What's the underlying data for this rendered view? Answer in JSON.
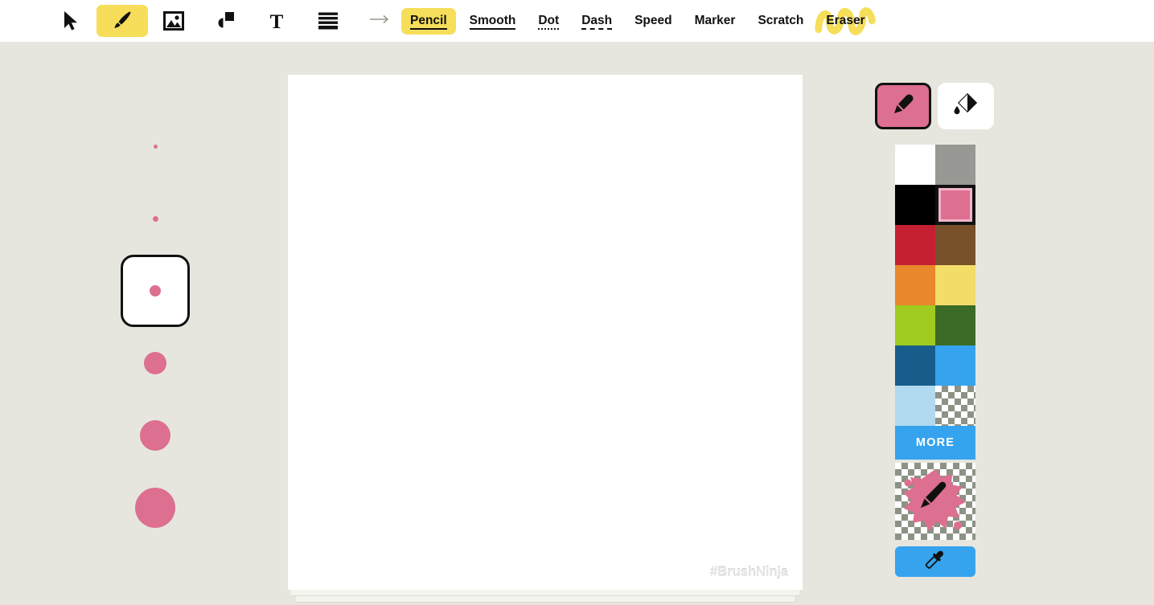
{
  "app": {
    "watermark": "#BrushNinja"
  },
  "toolbar": {
    "icon_tools": [
      {
        "name": "select-tool",
        "icon": "cursor-arrow-icon",
        "active": false
      },
      {
        "name": "brush-tool",
        "icon": "paintbrush-icon",
        "active": true
      },
      {
        "name": "image-tool",
        "icon": "image-icon",
        "active": false
      },
      {
        "name": "shapes-tool",
        "icon": "shapes-icon",
        "active": false
      },
      {
        "name": "text-tool",
        "icon": "text-t-icon",
        "active": false
      },
      {
        "name": "layers-tool",
        "icon": "layers-stack-icon",
        "active": false
      }
    ],
    "separator_icon": "arrow-right-icon",
    "brush_styles": [
      {
        "label": "Pencil",
        "style": "highlight",
        "selected": true
      },
      {
        "label": "Smooth",
        "style": "solid",
        "selected": false
      },
      {
        "label": "Dot",
        "style": "dotted",
        "selected": false
      },
      {
        "label": "Dash",
        "style": "dashed",
        "selected": false
      },
      {
        "label": "Speed",
        "style": "plain",
        "selected": false
      },
      {
        "label": "Marker",
        "style": "plain",
        "selected": false
      },
      {
        "label": "Scratch",
        "style": "plain",
        "selected": false
      },
      {
        "label": "Eraser",
        "style": "scribble",
        "selected": false
      }
    ]
  },
  "brush_sizes": {
    "selected_index": 2,
    "sizes": [
      {
        "label": "size-1",
        "diameter": 5
      },
      {
        "label": "size-2",
        "diameter": 7
      },
      {
        "label": "size-3",
        "diameter": 14
      },
      {
        "label": "size-4",
        "diameter": 28
      },
      {
        "label": "size-5",
        "diameter": 38
      },
      {
        "label": "size-6",
        "diameter": 50
      }
    ]
  },
  "color_panel": {
    "modes": [
      {
        "name": "pencil-mode",
        "icon": "pencil-icon",
        "active": true
      },
      {
        "name": "fill-mode",
        "icon": "paint-bucket-icon",
        "active": false
      }
    ],
    "selected_color": "#dd6f90",
    "swatches": [
      {
        "name": "white",
        "hex": "#ffffff",
        "selected": false
      },
      {
        "name": "gray",
        "hex": "#989894",
        "selected": false
      },
      {
        "name": "black",
        "hex": "#000000",
        "selected": false
      },
      {
        "name": "pink",
        "hex": "#dd6f90",
        "selected": true
      },
      {
        "name": "red",
        "hex": "#c42032",
        "selected": false
      },
      {
        "name": "brown",
        "hex": "#78512a",
        "selected": false
      },
      {
        "name": "orange",
        "hex": "#e8872b",
        "selected": false
      },
      {
        "name": "yellow",
        "hex": "#f3dd69",
        "selected": false
      },
      {
        "name": "lime",
        "hex": "#9fcb21",
        "selected": false
      },
      {
        "name": "green",
        "hex": "#3b6b26",
        "selected": false
      },
      {
        "name": "dark-blue",
        "hex": "#165d8c",
        "selected": false
      },
      {
        "name": "light-blue",
        "hex": "#36a3ef",
        "selected": false
      },
      {
        "name": "pale-blue",
        "hex": "#b1d9ef",
        "selected": false
      },
      {
        "name": "transparent",
        "hex": "transparent",
        "selected": false
      }
    ],
    "more_label": "MORE",
    "eyedropper_icon": "eyedropper-icon",
    "preview_icon": "paint-splat-pencil-icon"
  }
}
